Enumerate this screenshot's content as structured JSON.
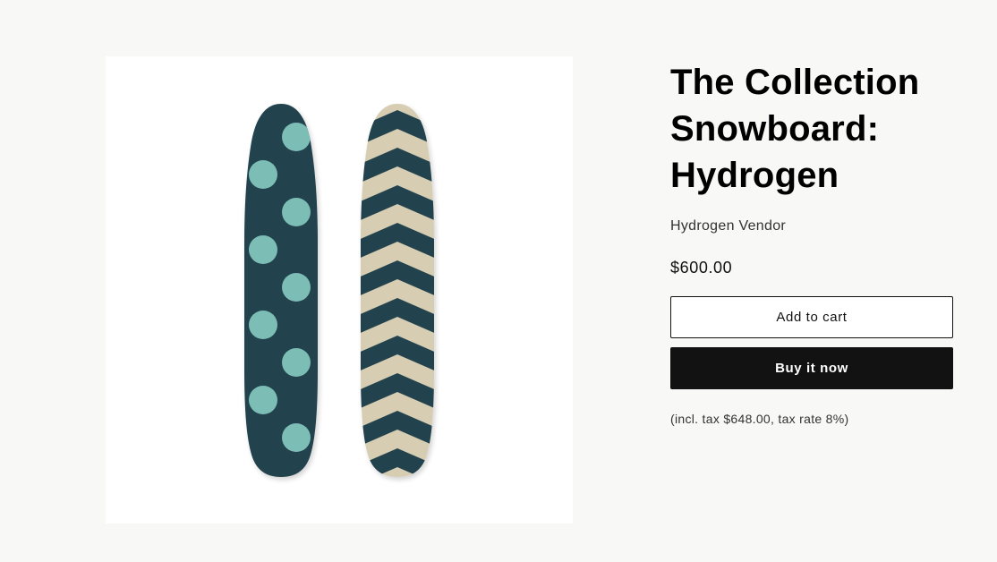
{
  "product": {
    "title": "The Collection Snowboard: Hydrogen",
    "vendor": "Hydrogen Vendor",
    "price": "$600.00",
    "tax_note": "(incl. tax $648.00, tax rate 8%)",
    "image_subject": "two-snowboards-dots-and-chevrons"
  },
  "actions": {
    "add_to_cart_label": "Add to cart",
    "buy_now_label": "Buy it now"
  },
  "colors": {
    "background": "#f8f8f6",
    "board_navy": "#23434d",
    "dot_teal": "#7bbdb5",
    "chevron_cream": "#d6cdb2",
    "buy_button": "#121212"
  }
}
